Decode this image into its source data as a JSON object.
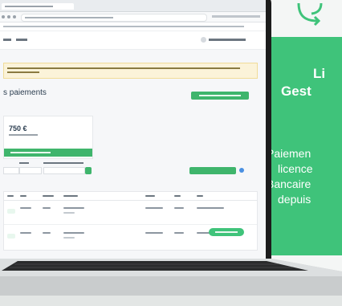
{
  "promo": {
    "title_line1": "Li",
    "title_line2": "Gest",
    "body_lines": [
      "Paiemen",
      "licence",
      "Bancaire",
      "depuis"
    ],
    "accent_color": "#3fc37a",
    "icon": "refresh-arrows-icon"
  },
  "screen": {
    "page_title": "s paiements",
    "balance_amount": "750 €",
    "accent_color": "#3fb56c"
  }
}
